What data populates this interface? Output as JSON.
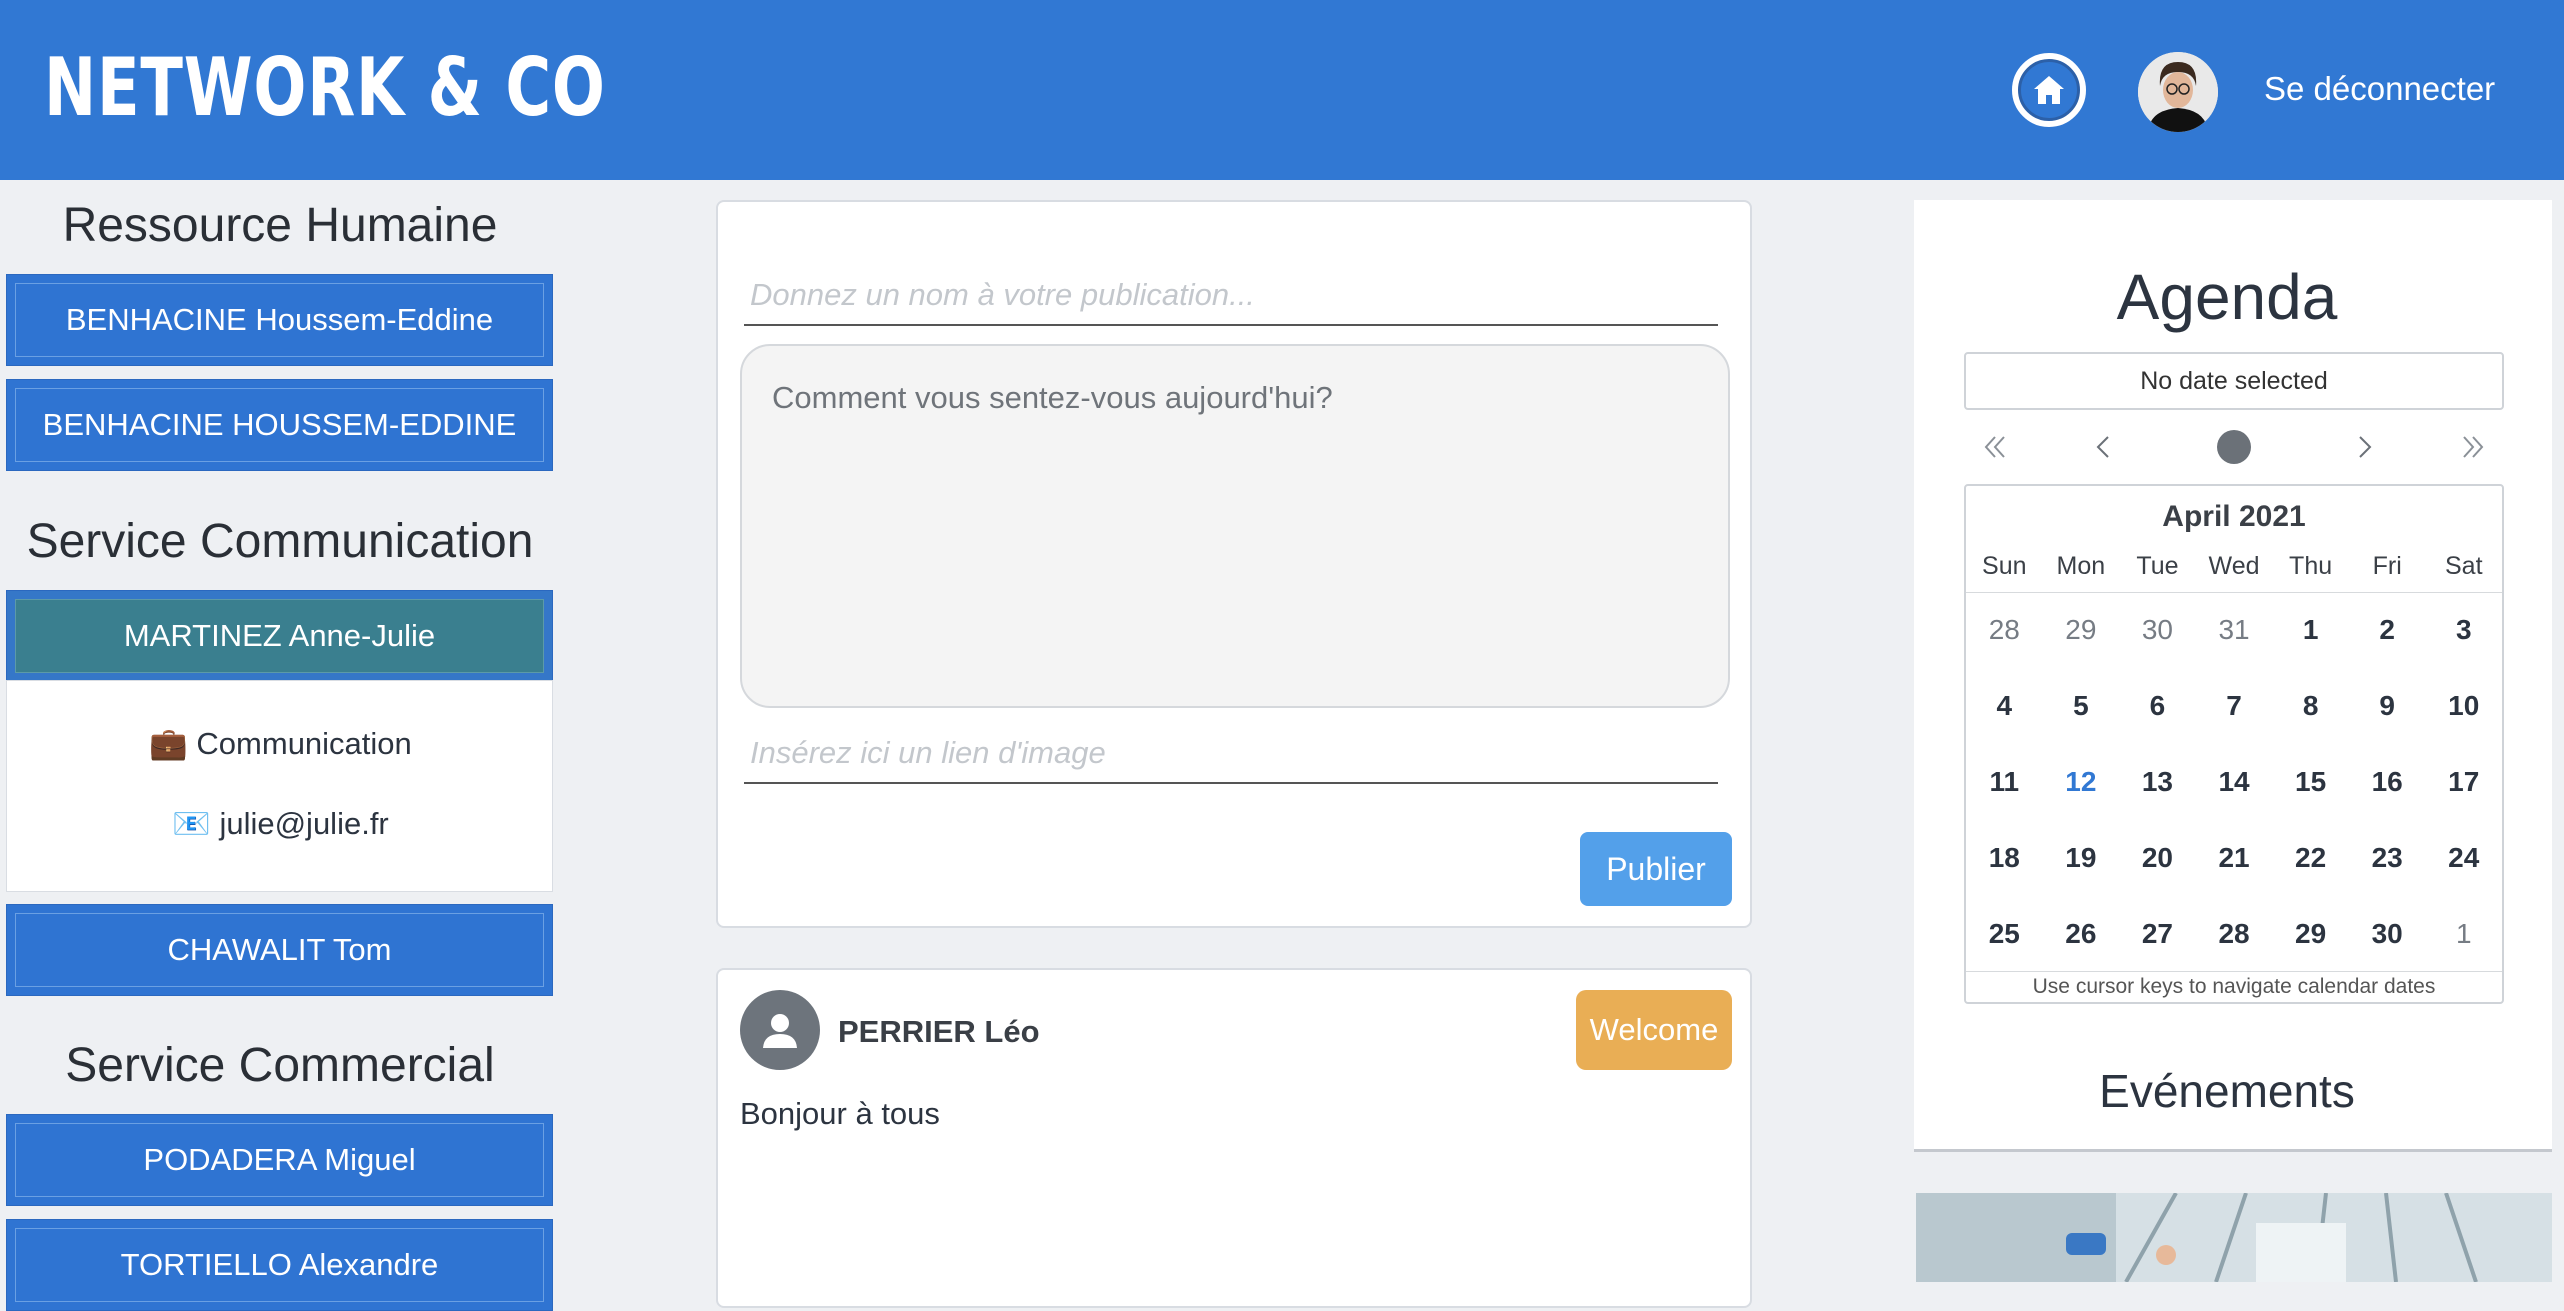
{
  "header": {
    "logo": "NETWORK & CO",
    "logout_label": "Se déconnecter"
  },
  "sidebar": {
    "departments": [
      {
        "title": "Ressource Humaine",
        "people": [
          "BENHACINE Houssem-Eddine",
          "BENHACINE HOUSSEM-EDDINE"
        ]
      },
      {
        "title": "Service Communication",
        "people": [
          "MARTINEZ Anne-Julie",
          "CHAWALIT Tom"
        ],
        "expanded": {
          "name": "MARTINEZ Anne-Julie",
          "job": "💼 Communication",
          "email": "📧 julie@julie.fr"
        }
      },
      {
        "title": "Service Commercial",
        "people": [
          "PODADERA Miguel",
          "TORTIELLO Alexandre"
        ]
      }
    ]
  },
  "composer": {
    "title_placeholder": "Donnez un nom à votre publication...",
    "body_placeholder": "Comment vous sentez-vous aujourd'hui?",
    "image_placeholder": "Insérez ici un lien d'image",
    "publish_label": "Publier"
  },
  "post": {
    "author": "PERRIER Léo",
    "badge": "Welcome",
    "text": "Bonjour à tous"
  },
  "agenda": {
    "title": "Agenda",
    "selected_date_text": "No date selected",
    "month_label": "April 2021",
    "weekdays": [
      "Sun",
      "Mon",
      "Tue",
      "Wed",
      "Thu",
      "Fri",
      "Sat"
    ],
    "weeks": [
      [
        "28",
        "29",
        "30",
        "31",
        "1",
        "2",
        "3"
      ],
      [
        "4",
        "5",
        "6",
        "7",
        "8",
        "9",
        "10"
      ],
      [
        "11",
        "12",
        "13",
        "14",
        "15",
        "16",
        "17"
      ],
      [
        "18",
        "19",
        "20",
        "21",
        "22",
        "23",
        "24"
      ],
      [
        "25",
        "26",
        "27",
        "28",
        "29",
        "30",
        "1"
      ]
    ],
    "today": "12",
    "hint": "Use cursor keys to navigate calendar dates",
    "events_title": "Evénements"
  },
  "colors": {
    "brand": "#3178d3",
    "active_person": "#3a7f8f",
    "publish": "#53a0ea",
    "badge": "#e9ae55"
  }
}
